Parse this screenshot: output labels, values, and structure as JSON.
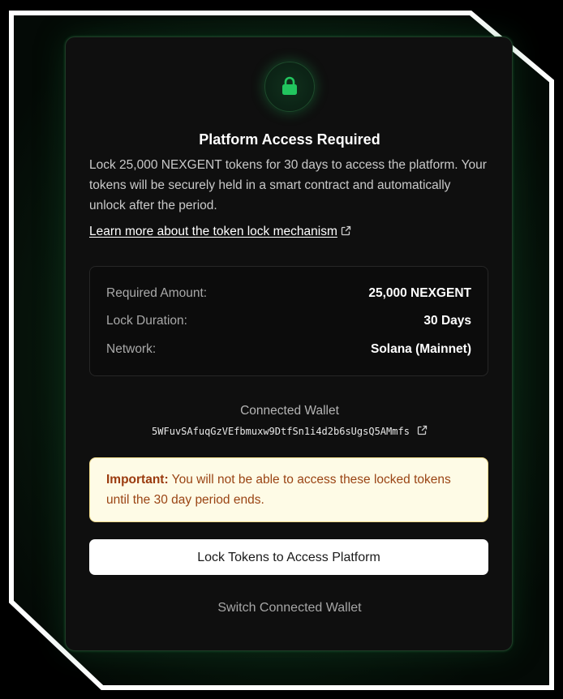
{
  "card": {
    "title": "Platform Access Required",
    "description": "Lock 25,000 NEXGENT tokens for 30 days to access the platform. Your tokens will be securely held in a smart contract and automatically unlock after the period.",
    "learn_more_link": "Learn more about the token lock mechanism",
    "details": [
      {
        "label": "Required Amount:",
        "value": "25,000 NEXGENT"
      },
      {
        "label": "Lock Duration:",
        "value": "30 Days"
      },
      {
        "label": "Network:",
        "value": "Solana (Mainnet)"
      }
    ],
    "wallet": {
      "label": "Connected Wallet",
      "address": "5WFuvSAfuqGzVEfbmuxw9DtfSn1i4d2b6sUgsQ5AMmfs"
    },
    "warning": {
      "prefix": "Important:",
      "text": "You will not be able to access these locked tokens until the 30 day period ends."
    },
    "primary_button": "Lock Tokens to Access Platform",
    "secondary_link": "Switch Connected Wallet"
  },
  "icons": {
    "header": "lock-icon",
    "learn_more": "external-link-icon",
    "wallet": "external-link-icon"
  },
  "colors": {
    "accent_green": "#22c55e",
    "card_background": "#0f0f0f",
    "warning_background": "#fefbe6",
    "warning_text": "#9a4414",
    "button_background": "#ffffff"
  }
}
